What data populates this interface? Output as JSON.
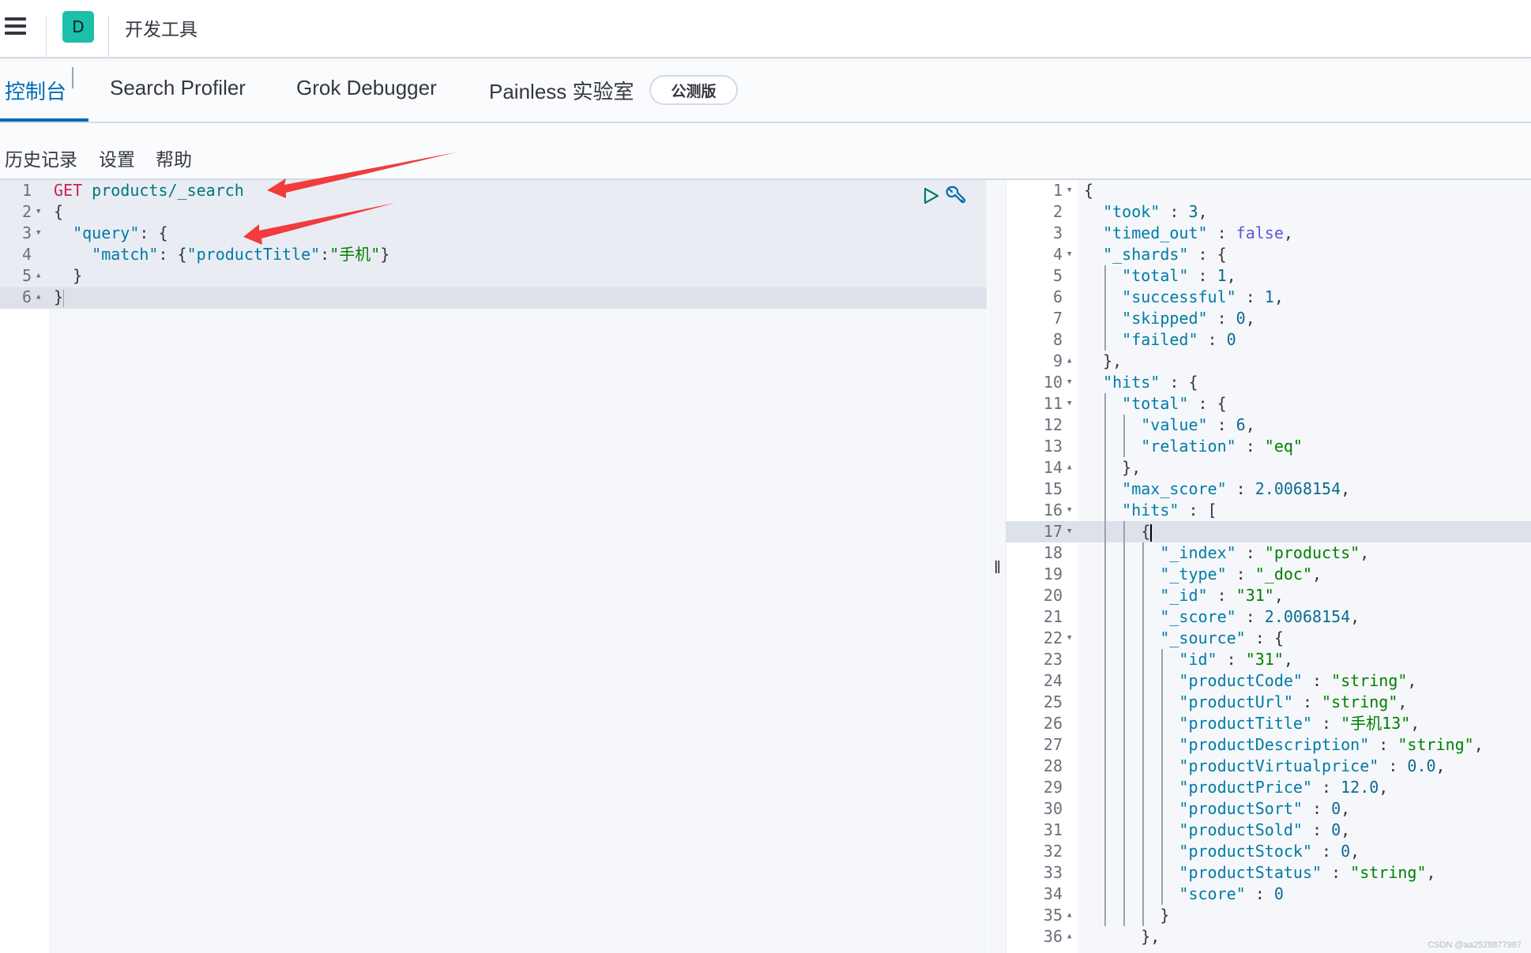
{
  "topbar": {
    "menu_icon": "hamburger-menu-icon",
    "logo_letter": "D",
    "app_title": "开发工具",
    "accent": "#1bbfaa"
  },
  "tabs": [
    {
      "label": "控制台",
      "active": true
    },
    {
      "label": "Search Profiler",
      "active": false
    },
    {
      "label": "Grok Debugger",
      "active": false
    },
    {
      "label": "Painless 实验室",
      "active": false
    }
  ],
  "beta_badge": "公测版",
  "menu": {
    "history": "历史记录",
    "settings": "设置",
    "help": "帮助"
  },
  "request_editor": {
    "lines": [
      {
        "n": "1",
        "fold": "",
        "tokens": [
          [
            "t-method",
            "GET"
          ],
          [
            "t-url",
            " products/_search"
          ]
        ]
      },
      {
        "n": "2",
        "fold": "▼",
        "tokens": [
          [
            "t-punc",
            "{"
          ]
        ]
      },
      {
        "n": "3",
        "fold": "▼",
        "tokens": [
          [
            "t-punc",
            "  "
          ],
          [
            "t-key",
            "\"query\""
          ],
          [
            "t-punc",
            ": {"
          ]
        ]
      },
      {
        "n": "4",
        "fold": "",
        "tokens": [
          [
            "t-punc",
            "    "
          ],
          [
            "t-key",
            "\"match\""
          ],
          [
            "t-punc",
            ": {"
          ],
          [
            "t-key",
            "\"productTitle\""
          ],
          [
            "t-punc",
            ":"
          ],
          [
            "t-str",
            "\"手机\""
          ],
          [
            "t-punc",
            "}"
          ]
        ]
      },
      {
        "n": "5",
        "fold": "▲",
        "tokens": [
          [
            "t-punc",
            "  }"
          ]
        ]
      },
      {
        "n": "6",
        "fold": "▲",
        "tokens": [
          [
            "t-punc",
            "}"
          ]
        ]
      }
    ],
    "run_icon": "play-icon",
    "settings_icon": "wrench-icon"
  },
  "response_editor": {
    "lines": [
      {
        "n": "1",
        "fold": "▼",
        "tokens": [
          [
            "t-punc",
            "{"
          ]
        ]
      },
      {
        "n": "2",
        "fold": "",
        "tokens": [
          [
            "t-punc",
            "  "
          ],
          [
            "t-key",
            "\"took\""
          ],
          [
            "t-punc",
            " : "
          ],
          [
            "t-num",
            "3"
          ],
          [
            "t-punc",
            ","
          ]
        ]
      },
      {
        "n": "3",
        "fold": "",
        "tokens": [
          [
            "t-punc",
            "  "
          ],
          [
            "t-key",
            "\"timed_out\""
          ],
          [
            "t-punc",
            " : "
          ],
          [
            "t-bool",
            "false"
          ],
          [
            "t-punc",
            ","
          ]
        ]
      },
      {
        "n": "4",
        "fold": "▼",
        "tokens": [
          [
            "t-punc",
            "  "
          ],
          [
            "t-key",
            "\"_shards\""
          ],
          [
            "t-punc",
            " : {"
          ]
        ]
      },
      {
        "n": "5",
        "fold": "",
        "tokens": [
          [
            "t-punc",
            "    "
          ],
          [
            "t-key",
            "\"total\""
          ],
          [
            "t-punc",
            " : "
          ],
          [
            "t-num",
            "1"
          ],
          [
            "t-punc",
            ","
          ]
        ]
      },
      {
        "n": "6",
        "fold": "",
        "tokens": [
          [
            "t-punc",
            "    "
          ],
          [
            "t-key",
            "\"successful\""
          ],
          [
            "t-punc",
            " : "
          ],
          [
            "t-num",
            "1"
          ],
          [
            "t-punc",
            ","
          ]
        ]
      },
      {
        "n": "7",
        "fold": "",
        "tokens": [
          [
            "t-punc",
            "    "
          ],
          [
            "t-key",
            "\"skipped\""
          ],
          [
            "t-punc",
            " : "
          ],
          [
            "t-num",
            "0"
          ],
          [
            "t-punc",
            ","
          ]
        ]
      },
      {
        "n": "8",
        "fold": "",
        "tokens": [
          [
            "t-punc",
            "    "
          ],
          [
            "t-key",
            "\"failed\""
          ],
          [
            "t-punc",
            " : "
          ],
          [
            "t-num",
            "0"
          ]
        ]
      },
      {
        "n": "9",
        "fold": "▲",
        "tokens": [
          [
            "t-punc",
            "  },"
          ]
        ]
      },
      {
        "n": "10",
        "fold": "▼",
        "tokens": [
          [
            "t-punc",
            "  "
          ],
          [
            "t-key",
            "\"hits\""
          ],
          [
            "t-punc",
            " : {"
          ]
        ]
      },
      {
        "n": "11",
        "fold": "▼",
        "tokens": [
          [
            "t-punc",
            "    "
          ],
          [
            "t-key",
            "\"total\""
          ],
          [
            "t-punc",
            " : {"
          ]
        ]
      },
      {
        "n": "12",
        "fold": "",
        "tokens": [
          [
            "t-punc",
            "      "
          ],
          [
            "t-key",
            "\"value\""
          ],
          [
            "t-punc",
            " : "
          ],
          [
            "t-num",
            "6"
          ],
          [
            "t-punc",
            ","
          ]
        ]
      },
      {
        "n": "13",
        "fold": "",
        "tokens": [
          [
            "t-punc",
            "      "
          ],
          [
            "t-key",
            "\"relation\""
          ],
          [
            "t-punc",
            " : "
          ],
          [
            "t-str",
            "\"eq\""
          ]
        ]
      },
      {
        "n": "14",
        "fold": "▲",
        "tokens": [
          [
            "t-punc",
            "    },"
          ]
        ]
      },
      {
        "n": "15",
        "fold": "",
        "tokens": [
          [
            "t-punc",
            "    "
          ],
          [
            "t-key",
            "\"max_score\""
          ],
          [
            "t-punc",
            " : "
          ],
          [
            "t-num",
            "2.0068154"
          ],
          [
            "t-punc",
            ","
          ]
        ]
      },
      {
        "n": "16",
        "fold": "▼",
        "tokens": [
          [
            "t-punc",
            "    "
          ],
          [
            "t-key",
            "\"hits\""
          ],
          [
            "t-punc",
            " : ["
          ]
        ]
      },
      {
        "n": "17",
        "fold": "▼",
        "tokens": [
          [
            "t-punc",
            "      {"
          ]
        ]
      },
      {
        "n": "18",
        "fold": "",
        "tokens": [
          [
            "t-punc",
            "        "
          ],
          [
            "t-key",
            "\"_index\""
          ],
          [
            "t-punc",
            " : "
          ],
          [
            "t-str",
            "\"products\""
          ],
          [
            "t-punc",
            ","
          ]
        ]
      },
      {
        "n": "19",
        "fold": "",
        "tokens": [
          [
            "t-punc",
            "        "
          ],
          [
            "t-key",
            "\"_type\""
          ],
          [
            "t-punc",
            " : "
          ],
          [
            "t-str",
            "\"_doc\""
          ],
          [
            "t-punc",
            ","
          ]
        ]
      },
      {
        "n": "20",
        "fold": "",
        "tokens": [
          [
            "t-punc",
            "        "
          ],
          [
            "t-key",
            "\"_id\""
          ],
          [
            "t-punc",
            " : "
          ],
          [
            "t-str",
            "\"31\""
          ],
          [
            "t-punc",
            ","
          ]
        ]
      },
      {
        "n": "21",
        "fold": "",
        "tokens": [
          [
            "t-punc",
            "        "
          ],
          [
            "t-key",
            "\"_score\""
          ],
          [
            "t-punc",
            " : "
          ],
          [
            "t-num",
            "2.0068154"
          ],
          [
            "t-punc",
            ","
          ]
        ]
      },
      {
        "n": "22",
        "fold": "▼",
        "tokens": [
          [
            "t-punc",
            "        "
          ],
          [
            "t-key",
            "\"_source\""
          ],
          [
            "t-punc",
            " : {"
          ]
        ]
      },
      {
        "n": "23",
        "fold": "",
        "tokens": [
          [
            "t-punc",
            "          "
          ],
          [
            "t-key",
            "\"id\""
          ],
          [
            "t-punc",
            " : "
          ],
          [
            "t-str",
            "\"31\""
          ],
          [
            "t-punc",
            ","
          ]
        ]
      },
      {
        "n": "24",
        "fold": "",
        "tokens": [
          [
            "t-punc",
            "          "
          ],
          [
            "t-key",
            "\"productCode\""
          ],
          [
            "t-punc",
            " : "
          ],
          [
            "t-str",
            "\"string\""
          ],
          [
            "t-punc",
            ","
          ]
        ]
      },
      {
        "n": "25",
        "fold": "",
        "tokens": [
          [
            "t-punc",
            "          "
          ],
          [
            "t-key",
            "\"productUrl\""
          ],
          [
            "t-punc",
            " : "
          ],
          [
            "t-str",
            "\"string\""
          ],
          [
            "t-punc",
            ","
          ]
        ]
      },
      {
        "n": "26",
        "fold": "",
        "tokens": [
          [
            "t-punc",
            "          "
          ],
          [
            "t-key",
            "\"productTitle\""
          ],
          [
            "t-punc",
            " : "
          ],
          [
            "t-str",
            "\"手机13\""
          ],
          [
            "t-punc",
            ","
          ]
        ]
      },
      {
        "n": "27",
        "fold": "",
        "tokens": [
          [
            "t-punc",
            "          "
          ],
          [
            "t-key",
            "\"productDescription\""
          ],
          [
            "t-punc",
            " : "
          ],
          [
            "t-str",
            "\"string\""
          ],
          [
            "t-punc",
            ","
          ]
        ]
      },
      {
        "n": "28",
        "fold": "",
        "tokens": [
          [
            "t-punc",
            "          "
          ],
          [
            "t-key",
            "\"productVirtualprice\""
          ],
          [
            "t-punc",
            " : "
          ],
          [
            "t-num",
            "0.0"
          ],
          [
            "t-punc",
            ","
          ]
        ]
      },
      {
        "n": "29",
        "fold": "",
        "tokens": [
          [
            "t-punc",
            "          "
          ],
          [
            "t-key",
            "\"productPrice\""
          ],
          [
            "t-punc",
            " : "
          ],
          [
            "t-num",
            "12.0"
          ],
          [
            "t-punc",
            ","
          ]
        ]
      },
      {
        "n": "30",
        "fold": "",
        "tokens": [
          [
            "t-punc",
            "          "
          ],
          [
            "t-key",
            "\"productSort\""
          ],
          [
            "t-punc",
            " : "
          ],
          [
            "t-num",
            "0"
          ],
          [
            "t-punc",
            ","
          ]
        ]
      },
      {
        "n": "31",
        "fold": "",
        "tokens": [
          [
            "t-punc",
            "          "
          ],
          [
            "t-key",
            "\"productSold\""
          ],
          [
            "t-punc",
            " : "
          ],
          [
            "t-num",
            "0"
          ],
          [
            "t-punc",
            ","
          ]
        ]
      },
      {
        "n": "32",
        "fold": "",
        "tokens": [
          [
            "t-punc",
            "          "
          ],
          [
            "t-key",
            "\"productStock\""
          ],
          [
            "t-punc",
            " : "
          ],
          [
            "t-num",
            "0"
          ],
          [
            "t-punc",
            ","
          ]
        ]
      },
      {
        "n": "33",
        "fold": "",
        "tokens": [
          [
            "t-punc",
            "          "
          ],
          [
            "t-key",
            "\"productStatus\""
          ],
          [
            "t-punc",
            " : "
          ],
          [
            "t-str",
            "\"string\""
          ],
          [
            "t-punc",
            ","
          ]
        ]
      },
      {
        "n": "34",
        "fold": "",
        "tokens": [
          [
            "t-punc",
            "          "
          ],
          [
            "t-key",
            "\"score\""
          ],
          [
            "t-punc",
            " : "
          ],
          [
            "t-num",
            "0"
          ]
        ]
      },
      {
        "n": "35",
        "fold": "▲",
        "tokens": [
          [
            "t-punc",
            "        }"
          ]
        ]
      },
      {
        "n": "36",
        "fold": "▲",
        "tokens": [
          [
            "t-punc",
            "      },"
          ]
        ]
      }
    ]
  },
  "splitter_icon": "drag-handle-icon",
  "annotation_color": "#f03c3c",
  "watermark": "CSDN @aa2528877987"
}
